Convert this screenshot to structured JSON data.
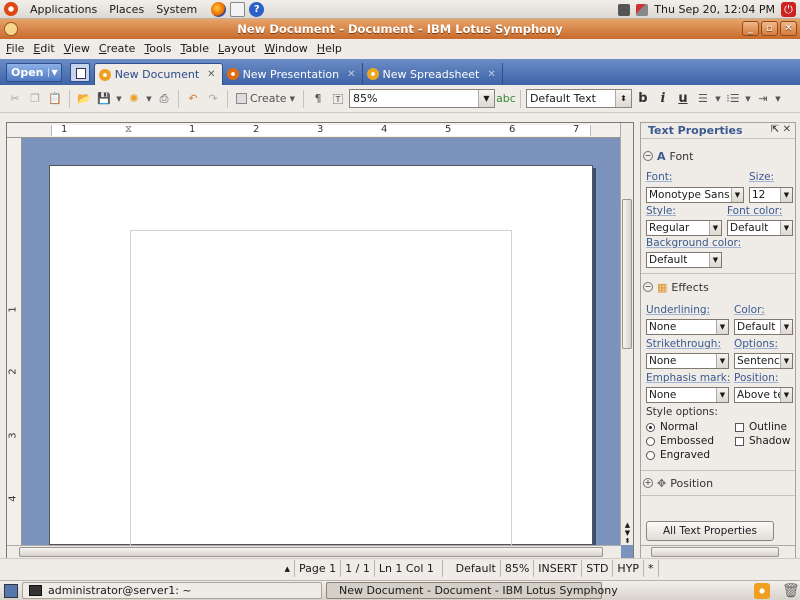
{
  "panel": {
    "menus": [
      "Applications",
      "Places",
      "System"
    ],
    "clock": "Thu Sep 20, 12:04 PM"
  },
  "window": {
    "title": "New Document - Document - IBM Lotus Symphony"
  },
  "menubar": [
    "File",
    "Edit",
    "View",
    "Create",
    "Tools",
    "Table",
    "Layout",
    "Window",
    "Help"
  ],
  "tabs": {
    "open_label": "Open",
    "items": [
      {
        "label": "New Document"
      },
      {
        "label": "New Presentation"
      },
      {
        "label": "New Spreadsheet"
      }
    ]
  },
  "toolbar": {
    "create_label": "Create",
    "zoom": "85%",
    "style": "Default Text",
    "bold": "b",
    "italic": "i",
    "underline": "u"
  },
  "ruler": {
    "h_ticks": [
      "1",
      "1",
      "2",
      "3",
      "4",
      "5",
      "6",
      "7"
    ],
    "v_ticks": [
      "1",
      "2",
      "3",
      "4"
    ]
  },
  "sidebar": {
    "title": "Text Properties",
    "font_section": {
      "heading": "Font",
      "font_label": "Font:",
      "font_value": "Monotype Sans W",
      "size_label": "Size:",
      "size_value": "12",
      "style_label": "Style:",
      "style_value": "Regular",
      "font_color_label": "Font color:",
      "font_color_value": "Default",
      "bg_color_label": "Background color:",
      "bg_color_value": "Default"
    },
    "effects_section": {
      "heading": "Effects",
      "underlining_label": "Underlining:",
      "underlining_value": "None",
      "color_label": "Color:",
      "color_value": "Default",
      "strike_label": "Strikethrough:",
      "strike_value": "None",
      "options_label": "Options:",
      "options_value": "Sentence",
      "emphasis_label": "Emphasis mark:",
      "emphasis_value": "None",
      "position_label": "Position:",
      "position_value": "Above tex",
      "style_options_label": "Style options:",
      "radio_normal": "Normal",
      "radio_embossed": "Embossed",
      "radio_engraved": "Engraved",
      "check_outline": "Outline",
      "check_shadow": "Shadow"
    },
    "position_section": {
      "heading": "Position"
    },
    "all_props_button": "All Text Properties"
  },
  "statusbar": {
    "page": "Page 1",
    "pages": "1 / 1",
    "cursor": "Ln 1 Col 1",
    "style": "Default",
    "zoom": "85%",
    "mode": "INSERT",
    "sel": "STD",
    "hyp": "HYP",
    "mod": "*"
  },
  "taskbar": {
    "items": [
      {
        "label": "administrator@server1: ~"
      },
      {
        "label": "New Document - Document - IBM Lotus Symphony"
      }
    ]
  }
}
